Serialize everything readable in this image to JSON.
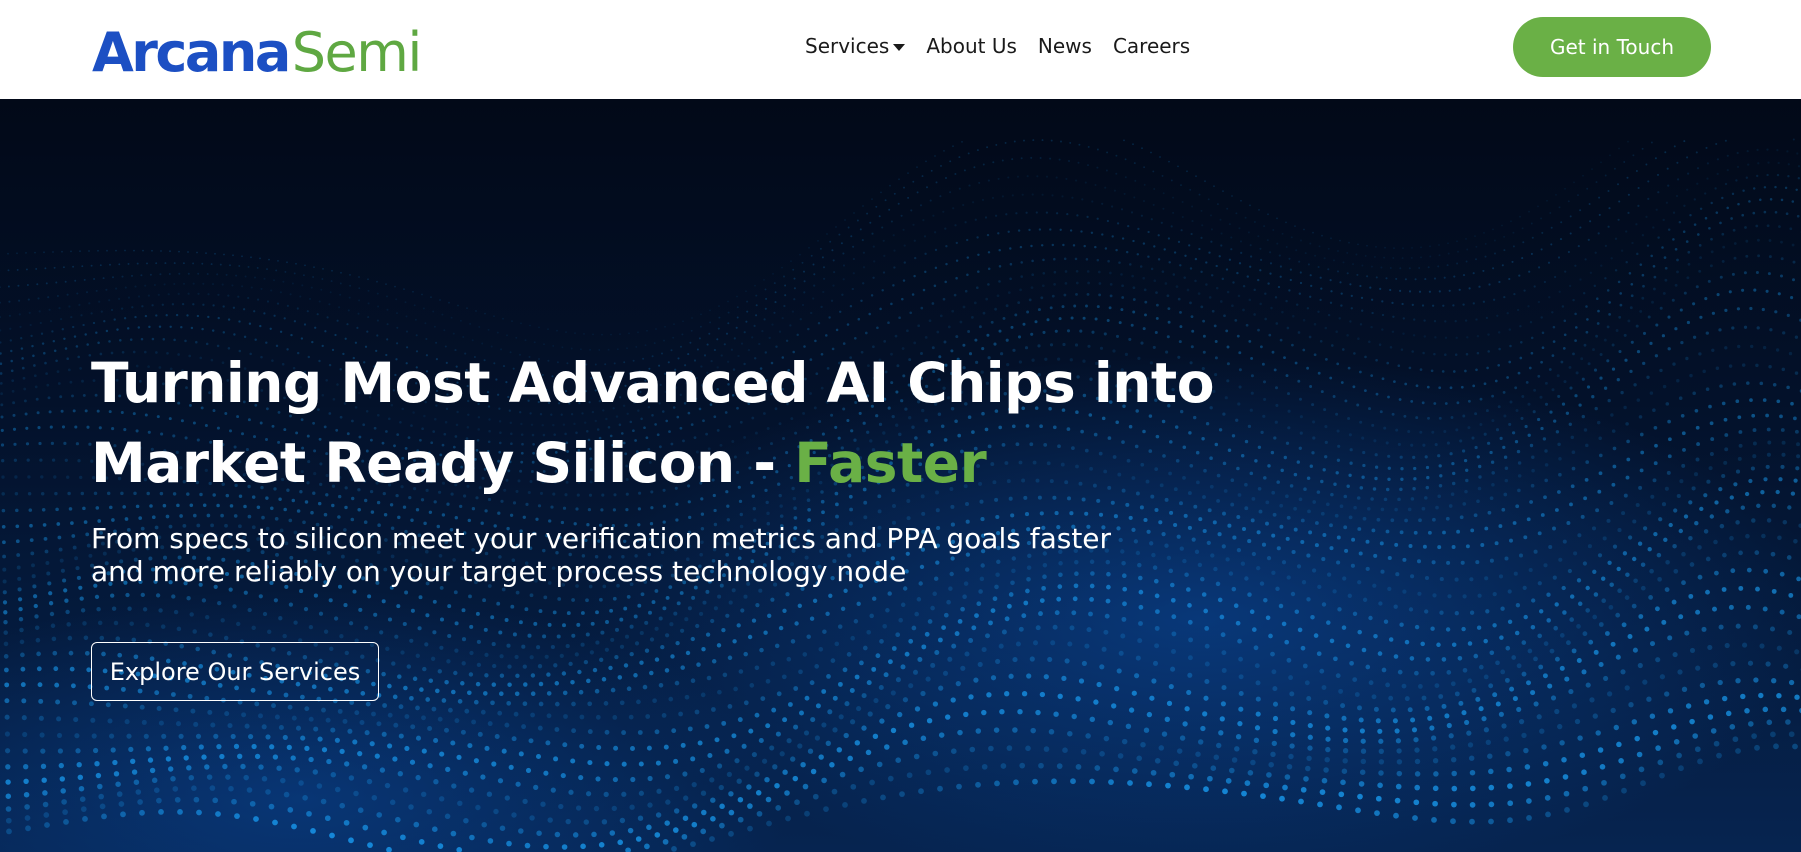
{
  "header": {
    "logo": {
      "part1": "Arcana",
      "part2": "Semi"
    },
    "nav": [
      {
        "label": "Services",
        "has_dropdown": true
      },
      {
        "label": "About Us"
      },
      {
        "label": "News"
      },
      {
        "label": "Careers"
      }
    ],
    "cta_label": "Get in Touch"
  },
  "hero": {
    "headline_line1": "Turning Most Advanced AI Chips into",
    "headline_line2": "Market Ready Silicon - ",
    "headline_accent": "Faster",
    "subhead_line1": "From specs to silicon meet your verification metrics and PPA goals faster",
    "subhead_line2": "and more reliably on your target process technology node",
    "button_label": "Explore Our Services"
  },
  "colors": {
    "brand_blue": "#1c4fc3",
    "brand_green": "#6ab046",
    "hero_bg": "#020b1c",
    "particle": "#1aa6ff"
  },
  "icons": {
    "services_dropdown": "caret-down-icon"
  }
}
